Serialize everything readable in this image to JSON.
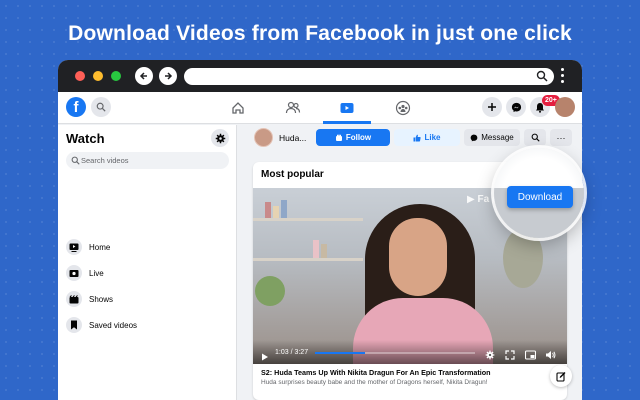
{
  "headline": "Download Videos from Facebook in just one click",
  "colors": {
    "background": "#2f67c9",
    "facebook_blue": "#1877f2",
    "badge_red": "#e41e3f"
  },
  "topbar": {
    "logo_letter": "f",
    "notifications_badge": "20+",
    "icons": [
      "home-icon",
      "friends-icon",
      "watch-icon",
      "groups-icon",
      "plus-icon",
      "messenger-icon",
      "bell-icon"
    ]
  },
  "sidebar": {
    "title": "Watch",
    "search_placeholder": "Search videos",
    "items": [
      {
        "label": "Home",
        "icon": "tv-icon"
      },
      {
        "label": "Live",
        "icon": "live-icon"
      },
      {
        "label": "Shows",
        "icon": "shows-icon"
      },
      {
        "label": "Saved videos",
        "icon": "bookmark-icon"
      }
    ]
  },
  "pagebar": {
    "page_name": "Huda...",
    "follow_label": "Follow",
    "like_label": "Like",
    "message_label": "Message",
    "more_label": "···"
  },
  "card": {
    "title": "Most popular",
    "watermark": "Fa eb",
    "video": {
      "timecode": "1:03 / 3:27",
      "progress": 0.31,
      "title": "S2: Huda Teams Up With Nikita Dragun For An Epic Transformation",
      "description": "Huda surprises beauty babe and the mother of Dragons herself, Nikita Dragun!"
    }
  },
  "download_label": "Download"
}
